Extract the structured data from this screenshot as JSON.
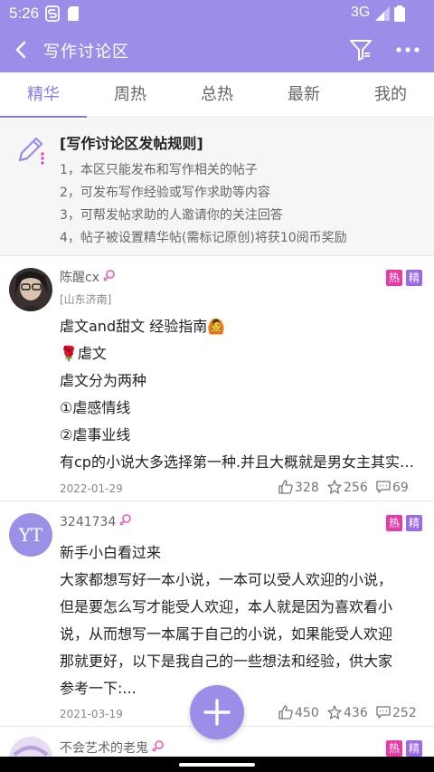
{
  "status_bar": {
    "time": "5:26",
    "network": "3G"
  },
  "header": {
    "title": "写作讨论区"
  },
  "tabs": [
    {
      "label": "精华",
      "active": true
    },
    {
      "label": "周热",
      "active": false
    },
    {
      "label": "总热",
      "active": false
    },
    {
      "label": "最新",
      "active": false
    },
    {
      "label": "我的",
      "active": false
    }
  ],
  "rules": {
    "title": "[写作讨论区发帖规则]",
    "lines": [
      "1，本区只能发布和写作相关的帖子",
      "2，可发布写作经验或写作求助等内容",
      "3，可帮发帖求助的人邀请你的关注回答",
      "4，帖子被设置精华帖(需标记原创)将获10阅币奖励"
    ]
  },
  "posts": [
    {
      "username": "陈醒cx",
      "location": "[山东济南]",
      "badges": [
        "热",
        "精"
      ],
      "lines": [
        "虐文and甜文 经验指南🙆",
        "🌹虐文",
        "虐文分为两种",
        "①虐感情线",
        "②虐事业线",
        "有cp的小说大多选择第一种.并且大概就是男女主其实是相爱的，但是因为种种原因"
      ],
      "date": "2022-01-29",
      "likes": "328",
      "favorites": "256",
      "comments": "69"
    },
    {
      "username": "3241734",
      "avatar_text": "YT",
      "badges": [
        "热",
        "精"
      ],
      "lines": [
        "新手小白看过来",
        "大家都想写好一本小说，一本可以受人欢迎的小说，",
        "但是要怎么写才能受人欢迎，本人就是因为喜欢看小",
        "说，从而想写一本属于自己的小说，如果能受人欢迎",
        "那就更好，以下是我自己的一些想法和经验，供大家",
        "参考一下:..."
      ],
      "date": "2021-03-19",
      "likes": "450",
      "favorites": "436",
      "comments": "252"
    },
    {
      "username": "不会艺术的老鬼",
      "badges": [
        "热",
        "精"
      ]
    }
  ],
  "colors": {
    "primary": "#9b8de8",
    "accent": "#8a7be0",
    "hot_badge": "#e83aa6",
    "essence_badge": "#9c6ae8"
  }
}
